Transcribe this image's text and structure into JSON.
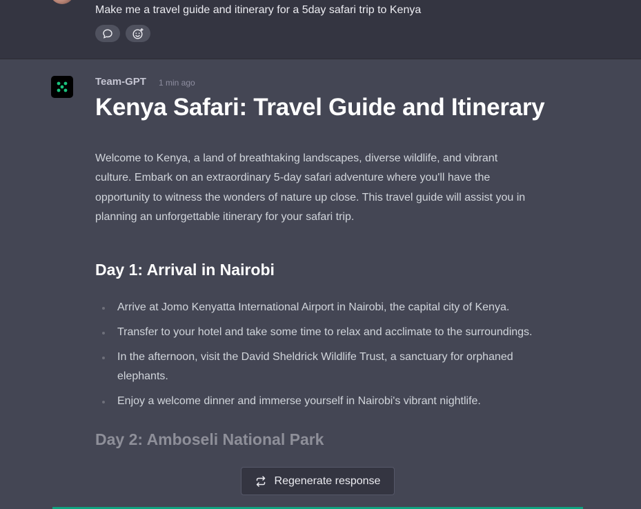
{
  "user_message": {
    "text": "Make me a travel guide and itinerary for a 5day safari trip to Kenya",
    "actions": [
      "comment-icon",
      "add-reaction-icon"
    ]
  },
  "bot_message": {
    "sender": "Team-GPT",
    "time": "1 min ago",
    "title": "Kenya Safari: Travel Guide and Itinerary",
    "intro": "Welcome to Kenya, a land of breathtaking landscapes, diverse wildlife, and vibrant culture. Embark on an extraordinary 5-day safari adventure where you'll have the opportunity to witness the wonders of nature up close. This travel guide will assist you in planning an unforgettable itinerary for your safari trip.",
    "day1": {
      "heading": "Day 1: Arrival in Nairobi",
      "items": [
        "Arrive at Jomo Kenyatta International Airport in Nairobi, the capital city of Kenya.",
        "Transfer to your hotel and take some time to relax and acclimate to the surroundings.",
        "In the afternoon, visit the David Sheldrick Wildlife Trust, a sanctuary for orphaned elephants.",
        "Enjoy a welcome dinner and immerse yourself in Nairobi's vibrant nightlife."
      ]
    },
    "day2": {
      "heading": "Day 2: Amboseli National Park"
    }
  },
  "regenerate_button": {
    "label": "Regenerate response",
    "icon": "regenerate-icon"
  },
  "colors": {
    "user_bg": "#343541",
    "bot_bg": "#444654",
    "accent": "#10a37f",
    "bot_logo": "#19c37d"
  }
}
